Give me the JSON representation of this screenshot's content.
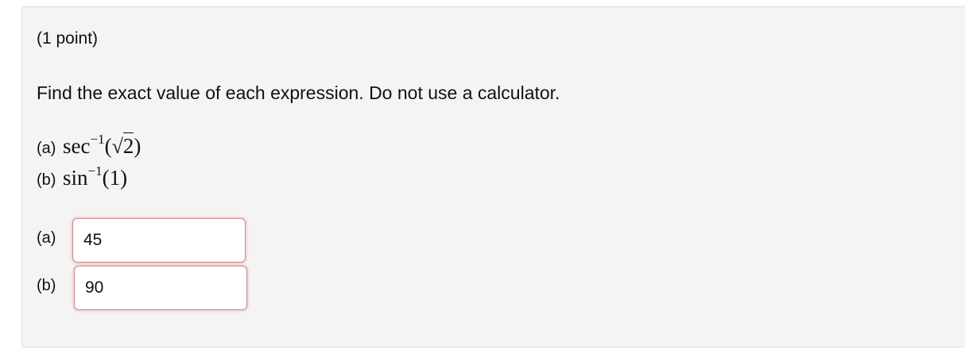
{
  "problem": {
    "points": "(1 point)",
    "instructions": "Find the exact value of each expression. Do not use a calculator.",
    "parts": [
      {
        "label": "(a)",
        "func": "sec",
        "exponent": "−1",
        "open_paren": "(",
        "sqrt_sign": "√",
        "radicand": "2",
        "close_paren": ")"
      },
      {
        "label": "(b)",
        "func": "sin",
        "exponent": "−1",
        "arg": "(1)"
      }
    ]
  },
  "answers": [
    {
      "label": "(a)",
      "value": "45"
    },
    {
      "label": "(b)",
      "value": "90"
    }
  ]
}
